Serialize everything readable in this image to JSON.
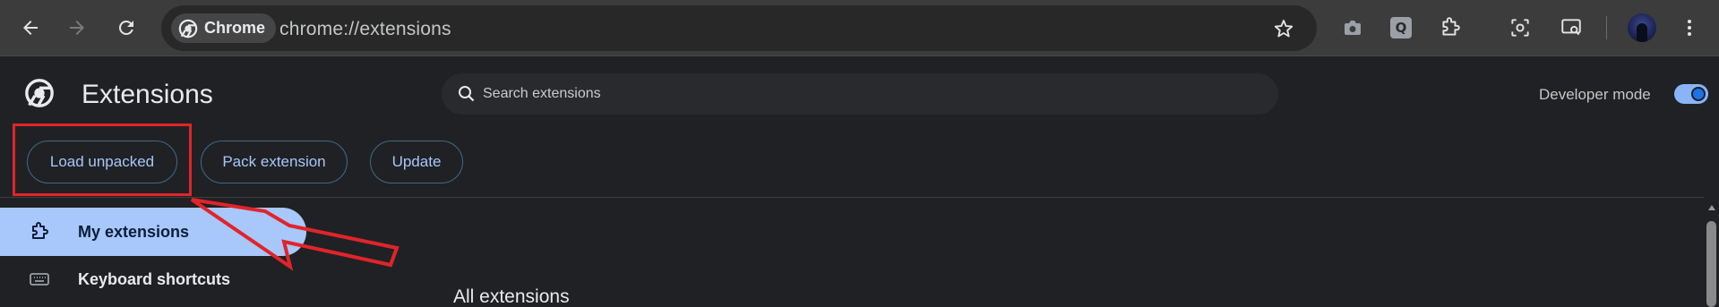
{
  "browser": {
    "chip_label": "Chrome",
    "url": "chrome://extensions"
  },
  "toolbar_icons": [
    "back-arrow-icon",
    "forward-arrow-icon",
    "reload-icon",
    "bookmark-star-icon",
    "camera-icon",
    "q-extension-icon",
    "puzzle-extensions-icon",
    "screenshot-lens-icon",
    "media-cast-icon",
    "profile-avatar",
    "kebab-menu-icon"
  ],
  "q_badge": "Q",
  "header": {
    "title": "Extensions",
    "search_placeholder": "Search extensions",
    "developer_mode_label": "Developer mode",
    "developer_mode_on": true
  },
  "actions": {
    "load_unpacked": "Load unpacked",
    "pack_extension": "Pack extension",
    "update": "Update"
  },
  "sidebar": {
    "items": [
      {
        "label": "My extensions",
        "icon": "puzzle-icon",
        "active": true
      },
      {
        "label": "Keyboard shortcuts",
        "icon": "keyboard-icon",
        "active": false
      }
    ]
  },
  "main": {
    "section_title": "All extensions"
  },
  "colors": {
    "accent": "#a8c7fa",
    "toggle": "#1a73e8",
    "annotation": "#e1242a",
    "page_bg": "#202124"
  }
}
